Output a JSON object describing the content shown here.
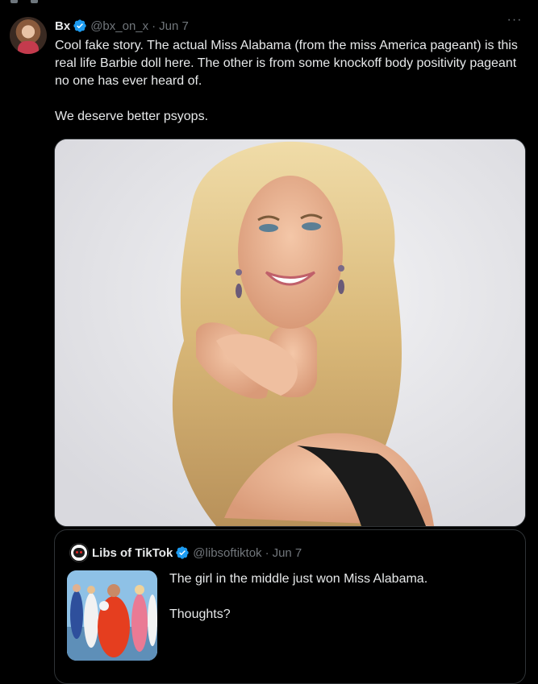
{
  "tweet": {
    "author_name": "Bx",
    "handle": "@bx_on_x",
    "separator": "·",
    "date": "Jun 7",
    "more_label": "···",
    "paragraph_1": "Cool fake story. The actual Miss Alabama (from the miss America pageant) is this real life Barbie doll here. The other is from some knockoff body positivity pageant no one has ever heard of.",
    "paragraph_2": "We deserve better psyops."
  },
  "quoted_tweet": {
    "author_name": "Libs of TikTok",
    "handle": "@libsoftiktok",
    "separator": "·",
    "date": "Jun 7",
    "paragraph_1": "The girl in the middle just won Miss Alabama.",
    "paragraph_2": "Thoughts?"
  },
  "colors": {
    "background": "#000000",
    "text_primary": "#e7e9ea",
    "text_secondary": "#71767b",
    "verified_badge": "#1d9bf0",
    "border": "#2f3336"
  },
  "icons": {
    "verified": "verified-badge-icon",
    "more": "more-options-icon"
  }
}
